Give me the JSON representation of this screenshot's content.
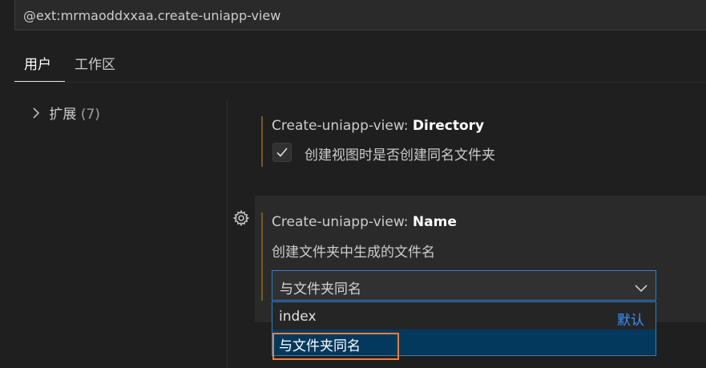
{
  "search": {
    "value": "@ext:mrmaoddxxaa.create-uniapp-view"
  },
  "tabs": [
    {
      "label": "用户"
    },
    {
      "label": "工作区"
    }
  ],
  "toc": {
    "label": "扩展",
    "count": "(7)"
  },
  "settings": {
    "directory": {
      "prefix": "Create-uniapp-view: ",
      "name": "Directory",
      "checkbox_label": "创建视图时是否创建同名文件夹",
      "checked": true
    },
    "name": {
      "prefix": "Create-uniapp-view: ",
      "name": "Name",
      "description": "创建文件夹中生成的文件名",
      "selected_value": "与文件夹同名",
      "options": [
        {
          "label": "index",
          "tag": "默认"
        },
        {
          "label": "与文件夹同名"
        }
      ]
    }
  },
  "colors": {
    "accent_focus": "#2f7fd1",
    "modified_bar": "#7a5a1e",
    "default_tag": "#3794ff",
    "highlight": "#e8803a"
  }
}
